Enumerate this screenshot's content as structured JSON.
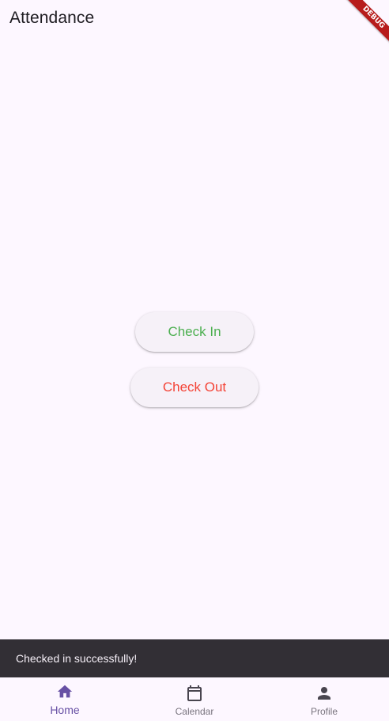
{
  "appbar": {
    "title": "Attendance"
  },
  "debug_banner": {
    "label": "DEBUG",
    "color": "#b71c1c"
  },
  "actions": {
    "check_in_label": "Check In",
    "check_out_label": "Check Out",
    "check_in_color": "#4caf50",
    "check_out_color": "#f44336"
  },
  "snackbar": {
    "message": "Checked in successfully!"
  },
  "bottom_nav": {
    "active_index": 0,
    "active_color": "#6750a4",
    "items": [
      {
        "label": "Home",
        "icon": "home-icon"
      },
      {
        "label": "Calendar",
        "icon": "calendar-icon"
      },
      {
        "label": "Profile",
        "icon": "person-icon"
      }
    ]
  }
}
